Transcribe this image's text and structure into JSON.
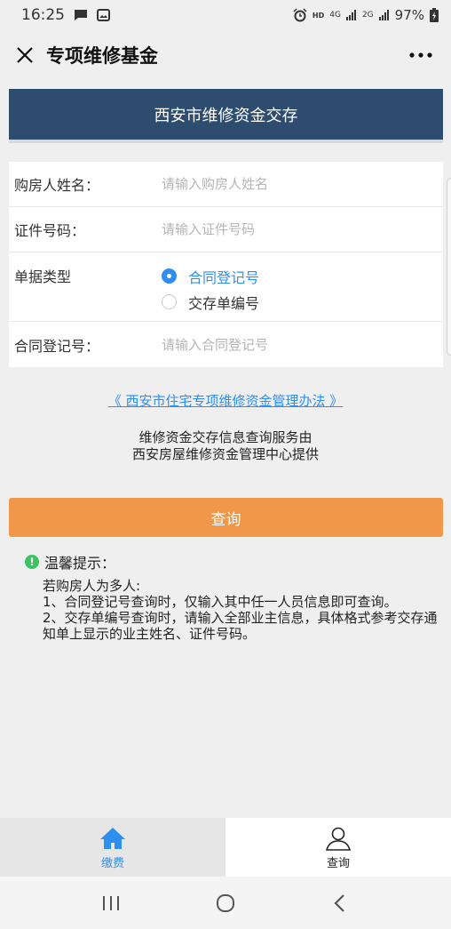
{
  "status_bar": {
    "time": "16:25",
    "hd": "HD",
    "network": "4G",
    "network2": "2G",
    "battery": "97%"
  },
  "title_bar": {
    "title": "专项维修基金"
  },
  "header": {
    "title": "西安市维修资金交存"
  },
  "form": {
    "buyer_name": {
      "label": "购房人姓名：",
      "placeholder": "请输入购房人姓名"
    },
    "id_number": {
      "label": "证件号码：",
      "placeholder": "请输入证件号码"
    },
    "doc_type": {
      "label": "单据类型",
      "options": [
        {
          "label": "合同登记号",
          "checked": true
        },
        {
          "label": "交存单编号",
          "checked": false
        }
      ]
    },
    "contract_no": {
      "label": "合同登记号：",
      "placeholder": "请输入合同登记号"
    }
  },
  "law_link": "《 西安市住宅专项维修资金管理办法 》",
  "service_info": {
    "line1": "维修资金交存信息查询服务由",
    "line2": "西安房屋维修资金管理中心提供"
  },
  "query_button": "查询",
  "tips": {
    "icon": "!",
    "title": "温馨提示：",
    "line1": "若购房人为多人:",
    "line2": "1、合同登记号查询时，仅输入其中任一人员信息即可查询。",
    "line3": "2、交存单编号查询时，请输入全部业主信息，具体格式参考交存通知单上显示的业主姓名、证件号码。"
  },
  "tabs": [
    {
      "label": "缴费",
      "icon": "home-icon",
      "active": true
    },
    {
      "label": "查询",
      "icon": "person-icon",
      "active": false
    }
  ],
  "colors": {
    "header_bg": "#2e4c6d",
    "accent_blue": "#2f8ff0",
    "button_orange": "#f0974a",
    "tip_green": "#3cc163"
  }
}
